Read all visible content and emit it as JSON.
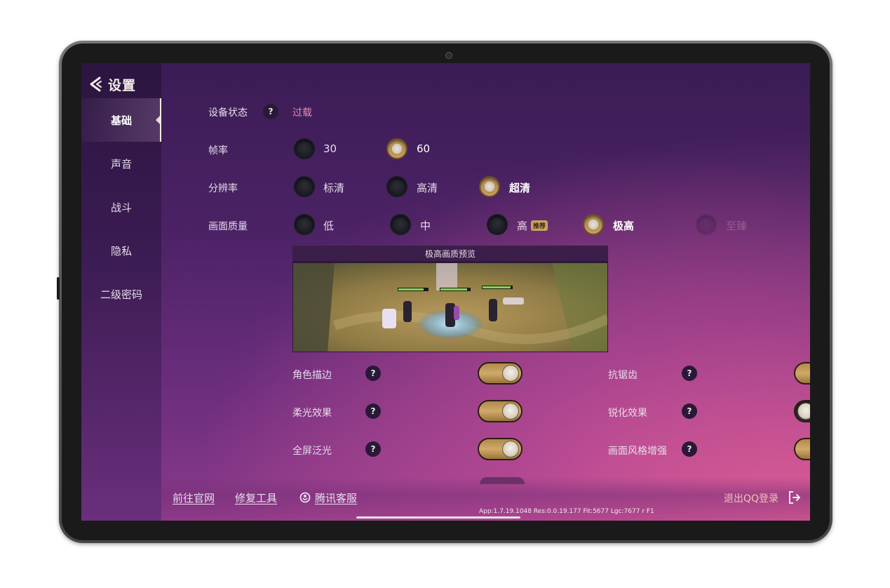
{
  "header": {
    "title": "设置"
  },
  "sidebar": {
    "items": [
      {
        "label": "基础",
        "active": true
      },
      {
        "label": "声音"
      },
      {
        "label": "战斗"
      },
      {
        "label": "隐私"
      },
      {
        "label": "二级密码"
      }
    ]
  },
  "settings": {
    "device_status": {
      "label": "设备状态",
      "value": "过载"
    },
    "frame_rate": {
      "label": "帧率",
      "options": [
        "30",
        "60"
      ],
      "selected": "60"
    },
    "resolution": {
      "label": "分辨率",
      "options": [
        "标清",
        "高清",
        "超清"
      ],
      "selected": "超清"
    },
    "quality": {
      "label": "画面质量",
      "options": [
        "低",
        "中",
        "高",
        "极高",
        "至臻"
      ],
      "badge": "推荐",
      "selected": "极高",
      "disabled": "至臻"
    },
    "preview": {
      "title": "极高画质预览"
    },
    "toggles": {
      "outline": {
        "label": "角色描边",
        "on": true
      },
      "antialias": {
        "label": "抗锯齿",
        "on": true
      },
      "bloom": {
        "label": "柔光效果",
        "on": true
      },
      "sharpen": {
        "label": "锐化效果",
        "on": false
      },
      "fullscreen_glow": {
        "label": "全屏泛光",
        "on": true
      },
      "style_enhance": {
        "label": "画面风格增强",
        "on": true
      }
    },
    "help_symbol": "?"
  },
  "footer": {
    "links": [
      "前往官网",
      "修复工具",
      "腾讯客服"
    ],
    "logout": "退出QQ登录",
    "version": "App:1.7.19.1048 Res:0.0.19.177 Fit:5677 Lgc:7677 r F1"
  },
  "colors": {
    "accent_gold": "#c9a060",
    "status_red": "#e58bb1",
    "bg_purple": "#4a2264",
    "bg_pink": "#e86296"
  }
}
